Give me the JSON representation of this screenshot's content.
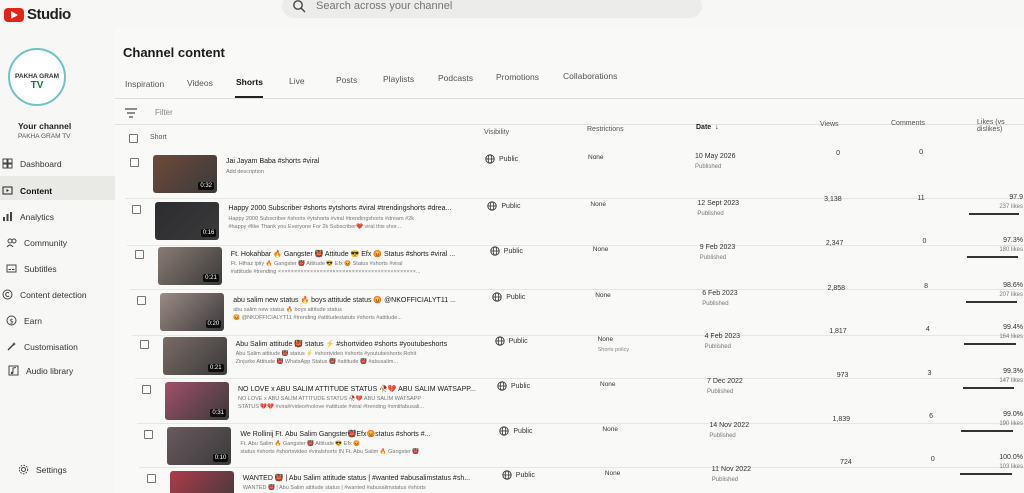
{
  "app": {
    "brand": "Studio"
  },
  "search": {
    "placeholder": "Search across your channel"
  },
  "sidebar": {
    "avatar_line1": "PAKHA GRAM",
    "avatar_line2": "TV",
    "your_channel": "Your channel",
    "channel_name": "PAKHA GRAM TV",
    "items": [
      {
        "label": "Dashboard",
        "icon": "dashboard-icon"
      },
      {
        "label": "Content",
        "icon": "content-icon"
      },
      {
        "label": "Analytics",
        "icon": "analytics-icon"
      },
      {
        "label": "Community",
        "icon": "community-icon"
      },
      {
        "label": "Subtitles",
        "icon": "subtitles-icon"
      },
      {
        "label": "Content detection",
        "icon": "copyright-icon"
      },
      {
        "label": "Earn",
        "icon": "dollar-icon"
      },
      {
        "label": "Customisation",
        "icon": "magic-wand-icon"
      },
      {
        "label": "Audio library",
        "icon": "audio-library-icon"
      },
      {
        "label": "Settings",
        "icon": "gear-icon"
      }
    ]
  },
  "main": {
    "title": "Channel content",
    "tabs": [
      "Inspiration",
      "Videos",
      "Shorts",
      "Live",
      "Posts",
      "Playlists",
      "Podcasts",
      "Promotions",
      "Collaborations"
    ],
    "active_tab": "Shorts",
    "filter": "Filter",
    "columns": {
      "short": "Short",
      "visibility": "Visibility",
      "restrictions": "Restrictions",
      "date": "Date",
      "views": "Views",
      "comments": "Comments",
      "likes": "Likes (vs dislikes)"
    }
  },
  "rows": [
    {
      "title": "Jai Jayam Baba #shorts #viral",
      "desc1": "Add description",
      "desc2": "",
      "duration": "0:32",
      "visibility": "Public",
      "restriction": "None",
      "restriction_sub": "",
      "date": "10 May 2026",
      "status": "Published",
      "views": "0",
      "comments": "0",
      "likes_pct": "",
      "likes": "",
      "likes_ratio": 0,
      "thumb_color": "#6f4a3a"
    },
    {
      "title": "Happy 2000 Subscriber #shorts #ytshorts #viral #trendingshorts #drea...",
      "desc1": "Happy 2000 Subscriber #shorts #ytshorts #viral #trendingshorts #dream #2k",
      "desc2": "#happy #like Thank you Everyone For 2k Subscriber❤️ viral this shor...",
      "duration": "0:16",
      "visibility": "Public",
      "restriction": "None",
      "restriction_sub": "",
      "date": "12 Sept 2023",
      "status": "Published",
      "views": "3,138",
      "comments": "11",
      "likes_pct": "97.9",
      "likes": "237 likes",
      "likes_ratio": 0.979,
      "thumb_color": "#2c2c30"
    },
    {
      "title": "Ft. Hokahbar 🔥 Gangster 👹 Attitude 😎 Efx 😡 Status #shorts #viral ...",
      "desc1": "Ft. Hifraz ipiiy 🔥 Gangster 👹 Attitude 😎 Efx 😡 Status #shorts #viral",
      "desc2": "#attitude #trending ×××××××××××××××××××××××××××××××××××××××××××...",
      "duration": "0:21",
      "visibility": "Public",
      "restriction": "None",
      "restriction_sub": "",
      "date": "9 Feb 2023",
      "status": "Published",
      "views": "2,347",
      "comments": "0",
      "likes_pct": "97.3%",
      "likes": "180 likes",
      "likes_ratio": 0.973,
      "thumb_color": "#8a7b73"
    },
    {
      "title": "abu salim new status 🔥 boys attitude status 😡 @NKOFFICIALYT11 ...",
      "desc1": "abu salim new status 🔥 boys attitude status",
      "desc2": "😡 @NKOFFICIALYT11 #trending #attitudestatuts #shorts #attitude...",
      "duration": "0:20",
      "visibility": "Public",
      "restriction": "None",
      "restriction_sub": "",
      "date": "6 Feb 2023",
      "status": "Published",
      "views": "2,858",
      "comments": "8",
      "likes_pct": "98.6%",
      "likes": "207 likes",
      "likes_ratio": 0.986,
      "thumb_color": "#9d8a86"
    },
    {
      "title": "Abu Salim attitude 👹 status ⚡ #shortvideo #shorts #youtubeshorts",
      "desc1": "Abu Salim attitude 👹 status ⚡ #shortvideo #shorts #youtubeshorts Rohit",
      "desc2": "Zinjurke Attitude 👹 WhatsApp Status 👹 #attitude 👹 #abusalim...",
      "duration": "0:21",
      "visibility": "Public",
      "restriction": "None",
      "restriction_sub": "Shorts policy",
      "date": "4 Feb 2023",
      "status": "Published",
      "views": "1,817",
      "comments": "4",
      "likes_pct": "99.4%",
      "likes": "164 likes",
      "likes_ratio": 0.994,
      "thumb_color": "#7a6b66"
    },
    {
      "title": "NO LOVE x ABU SALIM ATTITUDE STATUS 🥀💔 ABU SALIM WATSAPP...",
      "desc1": "NO LOVE x ABU SALIM ATTITUDE STATUS 🥀💔 ABU SALIM WATSAPP",
      "desc2": "STATUS 💔💔 #viral#video#nolove #attitude #viral #trending #xmlifabusali...",
      "duration": "0:31",
      "visibility": "Public",
      "restriction": "None",
      "restriction_sub": "",
      "date": "7 Dec 2022",
      "status": "Published",
      "views": "973",
      "comments": "3",
      "likes_pct": "99.3%",
      "likes": "147 likes",
      "likes_ratio": 0.993,
      "thumb_color": "#a0506a"
    },
    {
      "title": "We Rollinij Ft. Abu Salim Gangster👹Efx😡status #shorts #...",
      "desc1": "Ft. Abu Salim 🔥 Gangster 👹 Attitude 😎 Efx 😡",
      "desc2": "status #shorts #shortsvideo #viralshorts IN Ft. Abu Salim 🔥 Gangster 👹",
      "duration": "0:10",
      "visibility": "Public",
      "restriction": "None",
      "restriction_sub": "",
      "date": "14 Nov 2022",
      "status": "Published",
      "views": "1,839",
      "comments": "6",
      "likes_pct": "99.0%",
      "likes": "190 likes",
      "likes_ratio": 0.99,
      "thumb_color": "#6a5a60"
    },
    {
      "title": "WANTED 👹 | Abu Salim attitude status | #wanted #abusalimstatus #sh...",
      "desc1": "WANTED 👹 | Abu Salim attitude status | #wanted #abusalimstatus #shorts",
      "desc2": "",
      "duration": "",
      "visibility": "Public",
      "restriction": "None",
      "restriction_sub": "",
      "date": "11 Nov 2022",
      "status": "Published",
      "views": "724",
      "comments": "0",
      "likes_pct": "100.0%",
      "likes": "103 likes",
      "likes_ratio": 1.0,
      "thumb_color": "#b03a4a"
    }
  ]
}
